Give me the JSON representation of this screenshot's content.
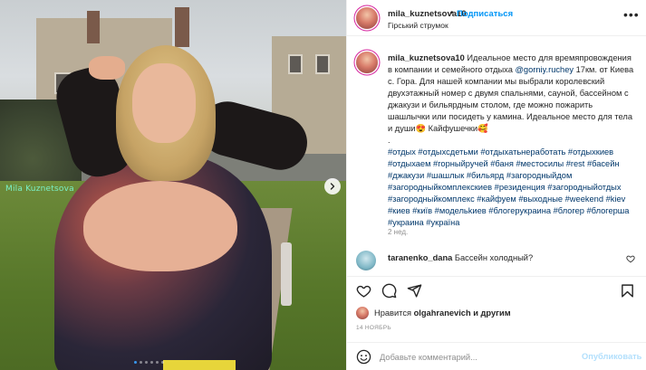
{
  "media": {
    "watermark": "Mila Kuznetsova",
    "slides": 6,
    "active_slide": 0,
    "next_icon": "chevron-right-icon"
  },
  "header": {
    "username": "mila_kuznetsova10",
    "separator": "•",
    "follow_label": "Подписаться",
    "location": "Гірський струмок",
    "more_icon": "more-horizontal-icon"
  },
  "caption": {
    "username": "mila_kuznetsova10",
    "text_before_mention": "Идеальное место для времяпровождения в компании и семейного отдыха ",
    "mention": "@gorniy.ruchey",
    "text_after_mention": " 17км. от Киева с. Гора. Для нашей компании мы выбрали королевский двухэтажный номер с двумя спальнями, сауной, бассейном с джакузи и бильярдным столом, где можно пожарить шашлычки или посидеть у камина. Идеальное место для тела и души😍 Кайфушечки🥰",
    "dot": ".",
    "hashtags": "#отдых #отдыхсдетьми #отдыхатьнеработать #отдыхкиев #отдыхаем #горныйручей #баня #местосилы #rest #басейн #джакузи #шашлык #бильярд #загородныйдом #загородныйкомплекскиев #резиденция #загородныйотдых #загородныйкомплекс #кайфуем #выходные #weekend #kiev #киев #київ #модельkиев #блогерукраина #блогер #блогерша #украина #україна",
    "time": "2 нед."
  },
  "comment": {
    "username": "taranenko_dana",
    "text": "Бассейн холодный?"
  },
  "actions": {
    "like_icon": "heart-icon",
    "comment_icon": "comment-icon",
    "share_icon": "share-icon",
    "save_icon": "bookmark-icon"
  },
  "likes": {
    "prefix": "Нравится ",
    "user": "olgahranevich",
    "suffix": " и другим"
  },
  "date": "14 НОЯБРЬ",
  "add_comment": {
    "placeholder": "Добавьте комментарий...",
    "publish_label": "Опубликовать",
    "emoji_icon": "emoji-icon"
  },
  "colors": {
    "accent": "#0095f6",
    "link": "#00376b",
    "muted": "#8e8e8e",
    "publish_disabled": "#b2dffc",
    "watermark": "#7af0c6"
  }
}
